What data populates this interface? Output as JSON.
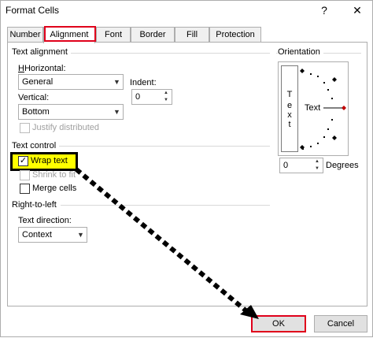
{
  "window": {
    "title": "Format Cells",
    "help": "?",
    "close": "✕"
  },
  "tabs": [
    {
      "label": "Number"
    },
    {
      "label": "Alignment"
    },
    {
      "label": "Font"
    },
    {
      "label": "Border"
    },
    {
      "label": "Fill"
    },
    {
      "label": "Protection"
    }
  ],
  "text_alignment": {
    "section": "Text alignment",
    "horizontal_label": "Horizontal:",
    "horizontal_value": "General",
    "vertical_label": "Vertical:",
    "vertical_value": "Bottom",
    "indent_label": "Indent:",
    "indent_value": "0",
    "justify_distributed": "Justify distributed"
  },
  "text_control": {
    "section": "Text control",
    "wrap_text": "Wrap text",
    "shrink_to_fit": "Shrink to fit",
    "merge_cells": "Merge cells"
  },
  "rtl": {
    "section": "Right-to-left",
    "direction_label": "Text direction:",
    "direction_value": "Context"
  },
  "orientation": {
    "section": "Orientation",
    "vertical_chars": [
      "T",
      "e",
      "x",
      "t"
    ],
    "horizontal_text": "Text",
    "degrees_value": "0",
    "degrees_label": "Degrees"
  },
  "buttons": {
    "ok": "OK",
    "cancel": "Cancel"
  },
  "colors": {
    "highlight_red": "#e0001b",
    "highlight_yellow": "#ffff00",
    "dial_red": "#c00000"
  }
}
